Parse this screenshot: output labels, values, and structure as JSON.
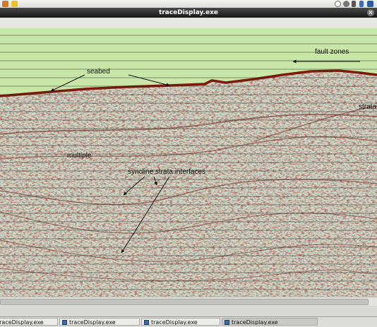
{
  "top_bar": {
    "icons": [
      "app-menu-icon",
      "notes-icon",
      "clock-icon",
      "power-icon",
      "volume-icon",
      "bluetooth-icon",
      "network-icon"
    ]
  },
  "window": {
    "title": "traceDisplay.exe",
    "close_glyph": "×"
  },
  "plot": {
    "annotations": {
      "fault_zones": "fault zones",
      "seabed": "seabed",
      "strata": "strata",
      "multiple": "multiple",
      "syncline": "syncline strata interfaces"
    },
    "colors": {
      "water": "#c8e6a8",
      "seabed_reflector": "#7a1a0a",
      "trace": "#6e2a22",
      "annotation": "#111111"
    }
  },
  "taskbar": {
    "items": [
      "traceDisplay.exe",
      "traceDisplay.exe",
      "traceDisplay.exe",
      "traceDisplay.exe"
    ],
    "active_index": 3
  }
}
